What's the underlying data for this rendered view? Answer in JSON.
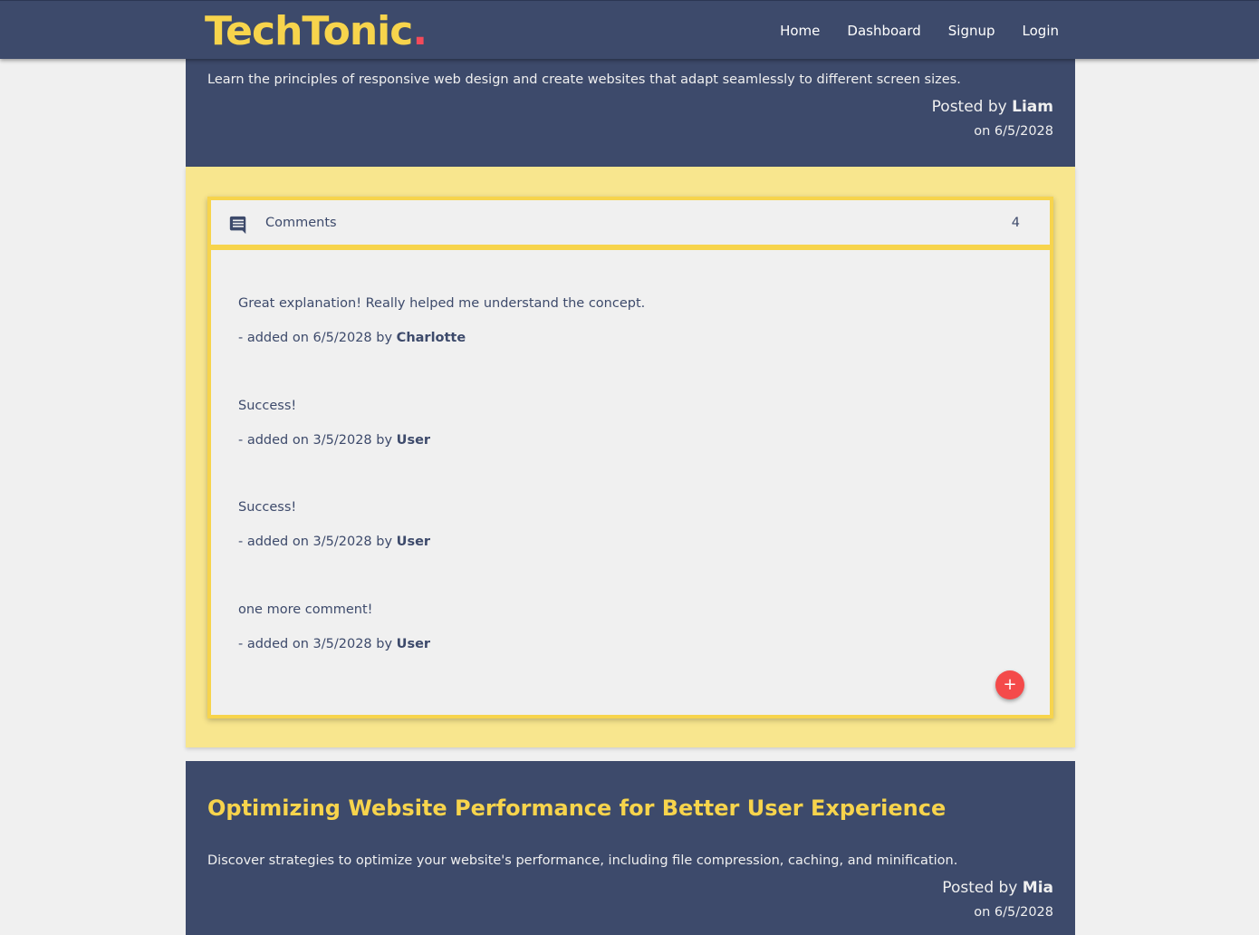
{
  "navbar": {
    "brand": "TechTonic",
    "brand_dot": ".",
    "links": [
      "Home",
      "Dashboard",
      "Signup",
      "Login"
    ]
  },
  "top_post": {
    "description": "Learn the principles of responsive web design and create websites that adapt seamlessly to different screen sizes.",
    "posted_by_prefix": "Posted by ",
    "author": "Liam",
    "date": "on 6/5/2028"
  },
  "comments": {
    "title": "Comments",
    "count": "4",
    "icon": "comment-icon",
    "items": [
      {
        "text": "Great explanation! Really helped me understand the concept.",
        "meta_prefix": "- added on 6/5/2028 by ",
        "author": "Charlotte"
      },
      {
        "text": "Success!",
        "meta_prefix": "- added on 3/5/2028 by ",
        "author": "User"
      },
      {
        "text": "Success!",
        "meta_prefix": "- added on 3/5/2028 by ",
        "author": "User"
      },
      {
        "text": "one more comment!",
        "meta_prefix": "- added on 3/5/2028 by ",
        "author": "User"
      }
    ],
    "add_label": "+"
  },
  "second_post": {
    "title": "Optimizing Website Performance for Better User Experience",
    "description": "Discover strategies to optimize your website's performance, including file compression, caching, and minification.",
    "posted_by_prefix": "Posted by ",
    "author": "Mia",
    "date": "on 6/5/2028"
  },
  "colors": {
    "navy": "#3d4a6b",
    "yellow": "#f7d44c",
    "pale_yellow": "#f8e68e",
    "red": "#f44a4a"
  }
}
